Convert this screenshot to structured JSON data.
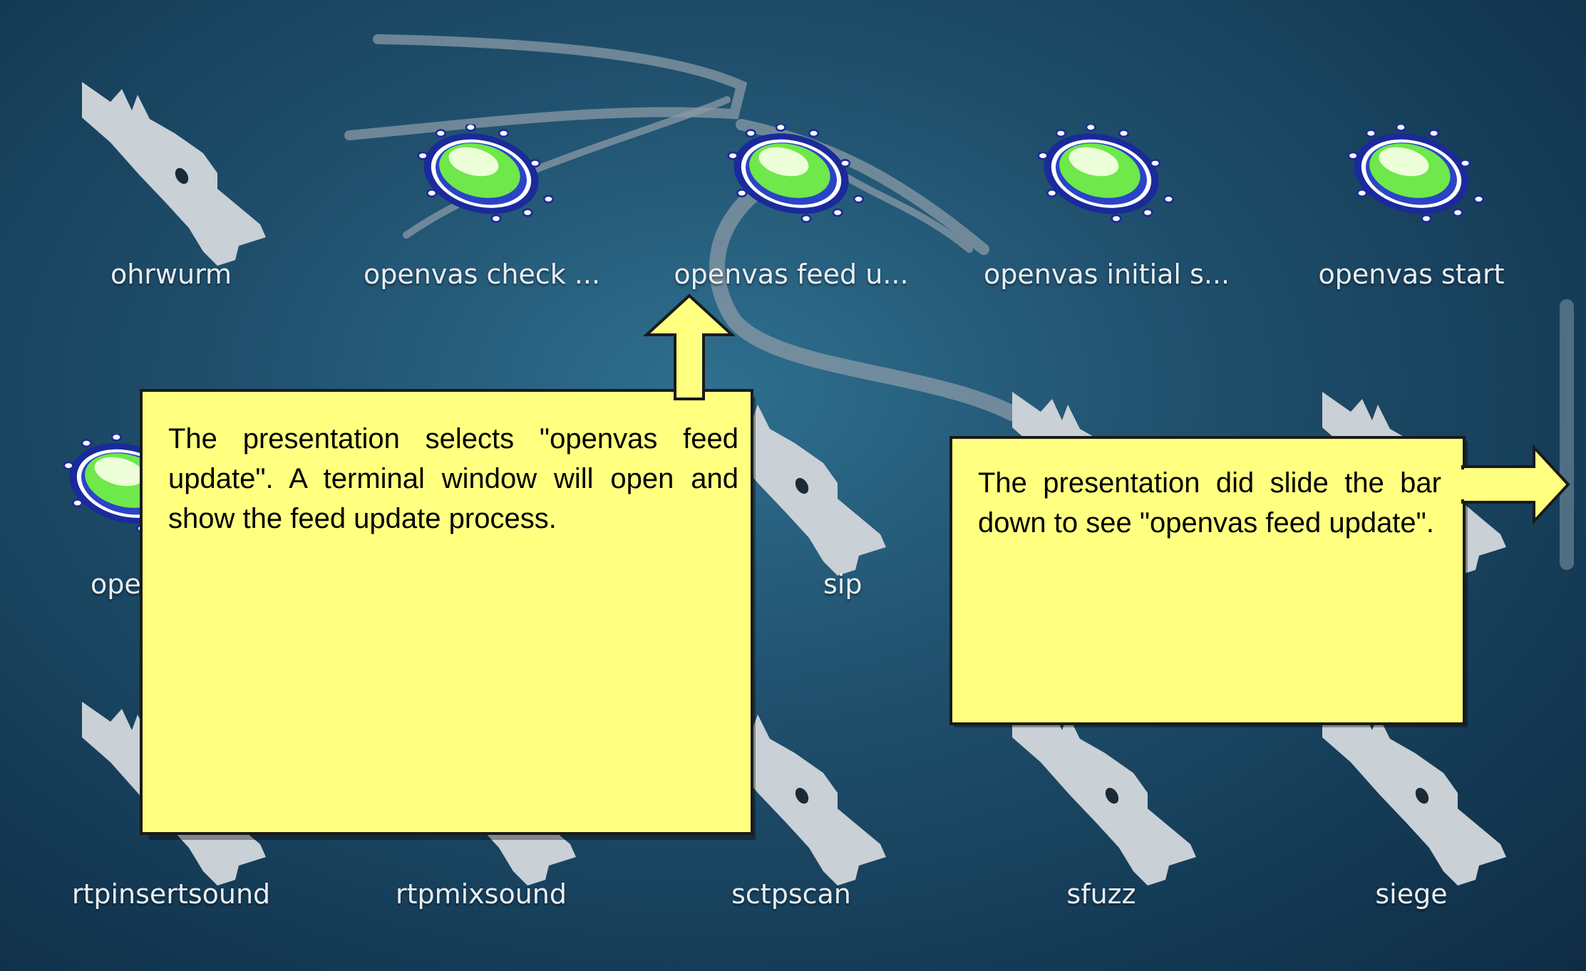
{
  "apps": [
    {
      "label": "ohrwurm",
      "icon": "kali-dragon-icon"
    },
    {
      "label": "openvas check ...",
      "icon": "openvas-icon"
    },
    {
      "label": "openvas feed u...",
      "icon": "openvas-icon"
    },
    {
      "label": "openvas initial s...",
      "icon": "openvas-icon"
    },
    {
      "label": "openvas start",
      "icon": "openvas-icon"
    },
    {
      "label": "ope",
      "icon": "openvas-icon"
    },
    {
      "label": "sip",
      "icon": "kali-dragon-icon"
    },
    {
      "label": "",
      "icon": "kali-dragon-icon"
    },
    {
      "label": "",
      "icon": "kali-dragon-icon"
    },
    {
      "label": "rtpinsertsound",
      "icon": "kali-dragon-icon"
    },
    {
      "label": "rtpmixsound",
      "icon": "kali-dragon-icon"
    },
    {
      "label": "sctpscan",
      "icon": "kali-dragon-icon"
    },
    {
      "label": "sfuzz",
      "icon": "kali-dragon-icon"
    },
    {
      "label": "siege",
      "icon": "kali-dragon-icon"
    }
  ],
  "callouts": {
    "left": "The presentation selects \"openvas feed update\". A terminal window will open and show the feed update process.",
    "right": "The presentation did slide the bar down to see \"openvas feed update\"."
  },
  "colors": {
    "callout_fill": "#ffff80",
    "callout_border": "#1a1a1a",
    "background": "#1f4f6c",
    "openvas_green": "#7dff4f",
    "openvas_blue": "#1a2a9a"
  }
}
